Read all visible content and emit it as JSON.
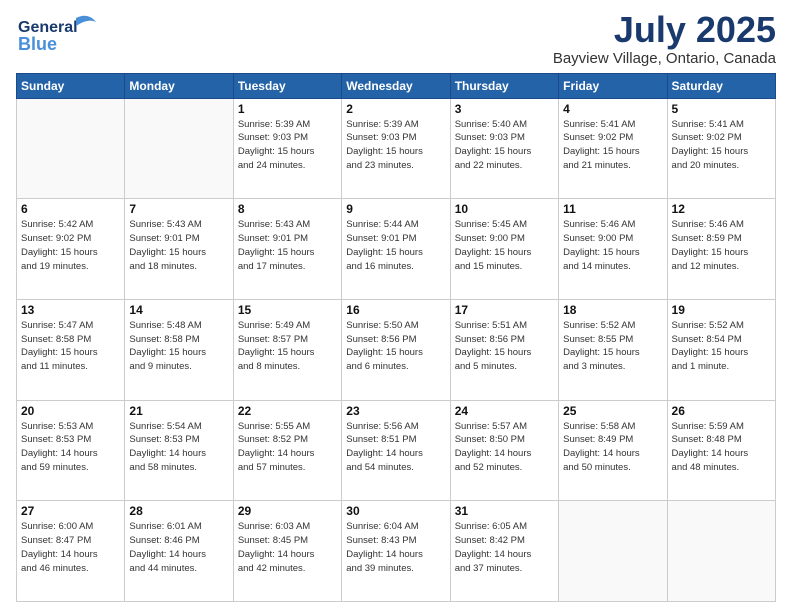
{
  "header": {
    "logo_line1": "General",
    "logo_line2": "Blue",
    "main_title": "July 2025",
    "sub_title": "Bayview Village, Ontario, Canada"
  },
  "weekdays": [
    "Sunday",
    "Monday",
    "Tuesday",
    "Wednesday",
    "Thursday",
    "Friday",
    "Saturday"
  ],
  "weeks": [
    [
      {
        "day": "",
        "info": ""
      },
      {
        "day": "",
        "info": ""
      },
      {
        "day": "1",
        "info": "Sunrise: 5:39 AM\nSunset: 9:03 PM\nDaylight: 15 hours\nand 24 minutes."
      },
      {
        "day": "2",
        "info": "Sunrise: 5:39 AM\nSunset: 9:03 PM\nDaylight: 15 hours\nand 23 minutes."
      },
      {
        "day": "3",
        "info": "Sunrise: 5:40 AM\nSunset: 9:03 PM\nDaylight: 15 hours\nand 22 minutes."
      },
      {
        "day": "4",
        "info": "Sunrise: 5:41 AM\nSunset: 9:02 PM\nDaylight: 15 hours\nand 21 minutes."
      },
      {
        "day": "5",
        "info": "Sunrise: 5:41 AM\nSunset: 9:02 PM\nDaylight: 15 hours\nand 20 minutes."
      }
    ],
    [
      {
        "day": "6",
        "info": "Sunrise: 5:42 AM\nSunset: 9:02 PM\nDaylight: 15 hours\nand 19 minutes."
      },
      {
        "day": "7",
        "info": "Sunrise: 5:43 AM\nSunset: 9:01 PM\nDaylight: 15 hours\nand 18 minutes."
      },
      {
        "day": "8",
        "info": "Sunrise: 5:43 AM\nSunset: 9:01 PM\nDaylight: 15 hours\nand 17 minutes."
      },
      {
        "day": "9",
        "info": "Sunrise: 5:44 AM\nSunset: 9:01 PM\nDaylight: 15 hours\nand 16 minutes."
      },
      {
        "day": "10",
        "info": "Sunrise: 5:45 AM\nSunset: 9:00 PM\nDaylight: 15 hours\nand 15 minutes."
      },
      {
        "day": "11",
        "info": "Sunrise: 5:46 AM\nSunset: 9:00 PM\nDaylight: 15 hours\nand 14 minutes."
      },
      {
        "day": "12",
        "info": "Sunrise: 5:46 AM\nSunset: 8:59 PM\nDaylight: 15 hours\nand 12 minutes."
      }
    ],
    [
      {
        "day": "13",
        "info": "Sunrise: 5:47 AM\nSunset: 8:58 PM\nDaylight: 15 hours\nand 11 minutes."
      },
      {
        "day": "14",
        "info": "Sunrise: 5:48 AM\nSunset: 8:58 PM\nDaylight: 15 hours\nand 9 minutes."
      },
      {
        "day": "15",
        "info": "Sunrise: 5:49 AM\nSunset: 8:57 PM\nDaylight: 15 hours\nand 8 minutes."
      },
      {
        "day": "16",
        "info": "Sunrise: 5:50 AM\nSunset: 8:56 PM\nDaylight: 15 hours\nand 6 minutes."
      },
      {
        "day": "17",
        "info": "Sunrise: 5:51 AM\nSunset: 8:56 PM\nDaylight: 15 hours\nand 5 minutes."
      },
      {
        "day": "18",
        "info": "Sunrise: 5:52 AM\nSunset: 8:55 PM\nDaylight: 15 hours\nand 3 minutes."
      },
      {
        "day": "19",
        "info": "Sunrise: 5:52 AM\nSunset: 8:54 PM\nDaylight: 15 hours\nand 1 minute."
      }
    ],
    [
      {
        "day": "20",
        "info": "Sunrise: 5:53 AM\nSunset: 8:53 PM\nDaylight: 14 hours\nand 59 minutes."
      },
      {
        "day": "21",
        "info": "Sunrise: 5:54 AM\nSunset: 8:53 PM\nDaylight: 14 hours\nand 58 minutes."
      },
      {
        "day": "22",
        "info": "Sunrise: 5:55 AM\nSunset: 8:52 PM\nDaylight: 14 hours\nand 57 minutes."
      },
      {
        "day": "23",
        "info": "Sunrise: 5:56 AM\nSunset: 8:51 PM\nDaylight: 14 hours\nand 54 minutes."
      },
      {
        "day": "24",
        "info": "Sunrise: 5:57 AM\nSunset: 8:50 PM\nDaylight: 14 hours\nand 52 minutes."
      },
      {
        "day": "25",
        "info": "Sunrise: 5:58 AM\nSunset: 8:49 PM\nDaylight: 14 hours\nand 50 minutes."
      },
      {
        "day": "26",
        "info": "Sunrise: 5:59 AM\nSunset: 8:48 PM\nDaylight: 14 hours\nand 48 minutes."
      }
    ],
    [
      {
        "day": "27",
        "info": "Sunrise: 6:00 AM\nSunset: 8:47 PM\nDaylight: 14 hours\nand 46 minutes."
      },
      {
        "day": "28",
        "info": "Sunrise: 6:01 AM\nSunset: 8:46 PM\nDaylight: 14 hours\nand 44 minutes."
      },
      {
        "day": "29",
        "info": "Sunrise: 6:03 AM\nSunset: 8:45 PM\nDaylight: 14 hours\nand 42 minutes."
      },
      {
        "day": "30",
        "info": "Sunrise: 6:04 AM\nSunset: 8:43 PM\nDaylight: 14 hours\nand 39 minutes."
      },
      {
        "day": "31",
        "info": "Sunrise: 6:05 AM\nSunset: 8:42 PM\nDaylight: 14 hours\nand 37 minutes."
      },
      {
        "day": "",
        "info": ""
      },
      {
        "day": "",
        "info": ""
      }
    ]
  ]
}
